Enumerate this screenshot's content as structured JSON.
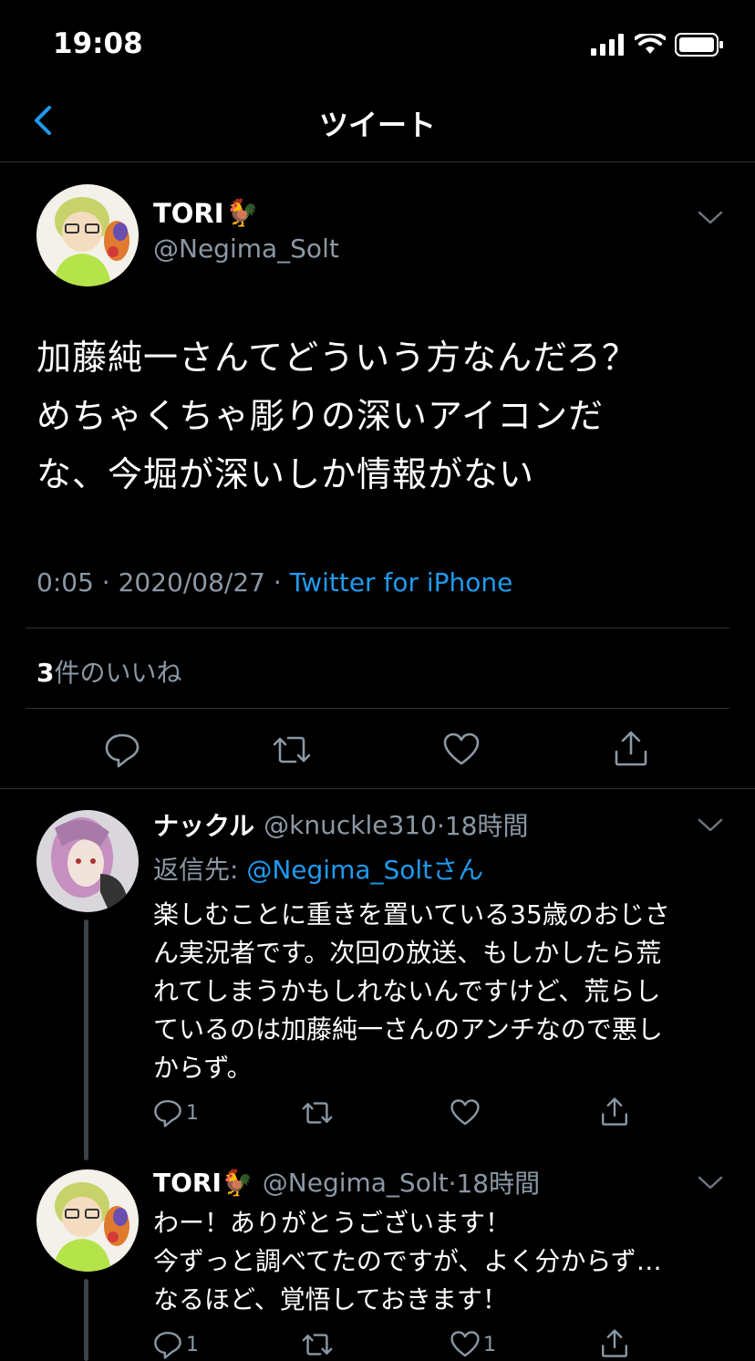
{
  "status_bar": {
    "time": "19:08"
  },
  "nav": {
    "title": "ツイート"
  },
  "tweet": {
    "name": "TORI",
    "emoji": "🐓",
    "handle": "@Negima_Solt",
    "text": "加藤純一さんてどういう方なんだろ？\nめちゃくちゃ彫りの深いアイコンだ\nな、今堀が深いしか情報がない",
    "time": "0:05",
    "sep1": "·",
    "date": "2020/08/27",
    "sep2": "·",
    "source": "Twitter for iPhone",
    "like_count": "3",
    "like_label": "件のいいね"
  },
  "replies": [
    {
      "name": "ナックル",
      "handle": "@knuckle310",
      "time": "·18時間",
      "reply_to_label": "返信先:",
      "reply_to_handle": "@Negima_Soltさん",
      "text": "楽しむことに重きを置いている35歳のおじさ\nん実況者です。次回の放送、もしかしたら荒\nれてしまうかもしれないんですけど、荒らし\nているのは加藤純一さんのアンチなので悪し\nからず。",
      "reply_count": "1",
      "like_count": ""
    },
    {
      "name": "TORI",
      "emoji": "🐓",
      "handle": "@Negima_Solt",
      "time": "·18時間",
      "text": "わー！ありがとうございます！\n今ずっと調べてたのですが、よく分からず…\nなるほど、覚悟しておきます！",
      "reply_count": "1",
      "like_count": "1"
    }
  ],
  "colors": {
    "background": "#000000",
    "secondary_text": "#8b98a5",
    "link": "#1d9bf0",
    "divider": "#2f3336"
  }
}
